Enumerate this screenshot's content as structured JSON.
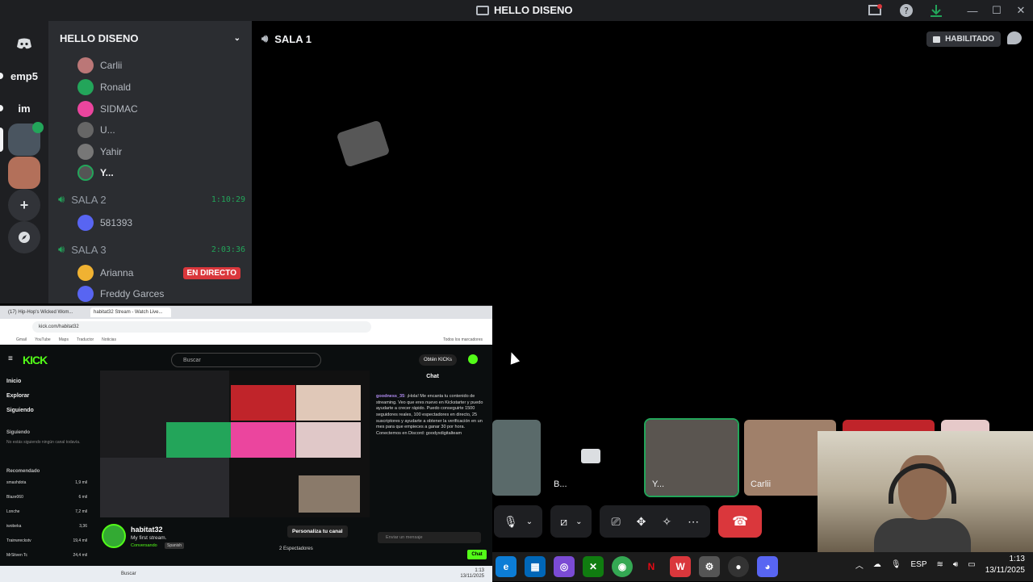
{
  "window": {
    "title": "HELLO DISENO"
  },
  "guilds": [
    {
      "label": "emp5"
    },
    {
      "label": "im"
    }
  ],
  "server": {
    "name": "HELLO DISENO",
    "members_top": [
      {
        "name": "Carlii",
        "color": "#b77"
      },
      {
        "name": "Ronald",
        "color": "#23a55a"
      },
      {
        "name": "SIDMAC",
        "color": "#eb459e"
      },
      {
        "name": "U...",
        "color": "#666"
      },
      {
        "name": "Yahir",
        "color": "#777"
      },
      {
        "name": "Y...",
        "color": "#23a55a"
      }
    ],
    "voice_channels": [
      {
        "name": "SALA 2",
        "timer": "1:10:29",
        "members": [
          {
            "name": "581393",
            "color": "#5865f2"
          }
        ]
      },
      {
        "name": "SALA 3",
        "timer": "2:03:36",
        "members": [
          {
            "name": "Arianna",
            "color": "#f0b232",
            "badge": "EN DIRECTO"
          },
          {
            "name": "Freddy Garces",
            "color": "#5865f2"
          }
        ]
      }
    ]
  },
  "stage": {
    "channel_name": "SALA 1",
    "habilitado": "HABILITADO",
    "tiles": [
      {
        "name": ""
      },
      {
        "name": "B..."
      },
      {
        "name": "Y..."
      },
      {
        "name": "Carlii"
      },
      {
        "name": ""
      },
      {
        "name": ""
      }
    ]
  },
  "kick": {
    "tab1": "(17) Hip-Hop's Wicked Wom...",
    "tab2": "habitat32 Stream - Watch Live...",
    "url": "kick.com/habitat32",
    "bookmarks": [
      "Gmail",
      "YouTube",
      "Maps",
      "Traductor",
      "Noticias",
      "Todos los marcadores"
    ],
    "logo": "KICK",
    "search_placeholder": "Buscar",
    "kicks_btn": "Obtén KICKs",
    "nav": [
      "Inicio",
      "Explorar",
      "Siguiendo"
    ],
    "following_title": "Siguiendo",
    "following_empty": "No estás siguiendo ningún canal todavía.",
    "recommended_title": "Recomendado",
    "recommended": [
      {
        "name": "smashdota",
        "game": "Dota 2",
        "viewers": "1,9 mil"
      },
      {
        "name": "Blaze060",
        "game": "Minecraft",
        "viewers": "6 mil"
      },
      {
        "name": "Lonche",
        "game": "Grand Theft Auto V",
        "viewers": "7,2 mil"
      },
      {
        "name": "iwobeka",
        "game": "Dota 2",
        "viewers": "3,36"
      },
      {
        "name": "Trainwreckstv",
        "game": "Slots & Casino",
        "viewers": "19,4 mil"
      },
      {
        "name": "MrStiven Tc",
        "game": "",
        "viewers": "24,4 mil"
      }
    ],
    "chat_title": "Chat",
    "chat_user": "goodness_35",
    "chat_message": ": ¡Hola! Me encanta tu contenido de streaming. Veo que eres nuevo en Kickstarter y puedo ayudarte a crecer rápido. Puedo conseguirte 1500 seguidores reales, 100 espectadores en directo, 25 suscriptores y ayudarte a obtener la verificación en un mes para que empieces a ganar 30 por hora. Conectemos en Discord: goodyxdigitalteam",
    "chat_placeholder": "Enviar un mensaje",
    "chat_button": "Chat",
    "streamer": "habitat32",
    "stream_title": "My first stream.",
    "category": "Conversando",
    "language": "Spanish",
    "customize_btn": "Personaliza tu canal",
    "spectators": "2 Espectadores",
    "pip_search": "Buscar",
    "pip_clock_time": "1:13",
    "pip_clock_date": "13/11/2025"
  },
  "taskbar": {
    "lang": "ESP",
    "time": "1:13",
    "date": "13/11/2025"
  },
  "colors": {
    "green": "#23a55a",
    "kick_green": "#53fc18",
    "red": "#da373c"
  }
}
